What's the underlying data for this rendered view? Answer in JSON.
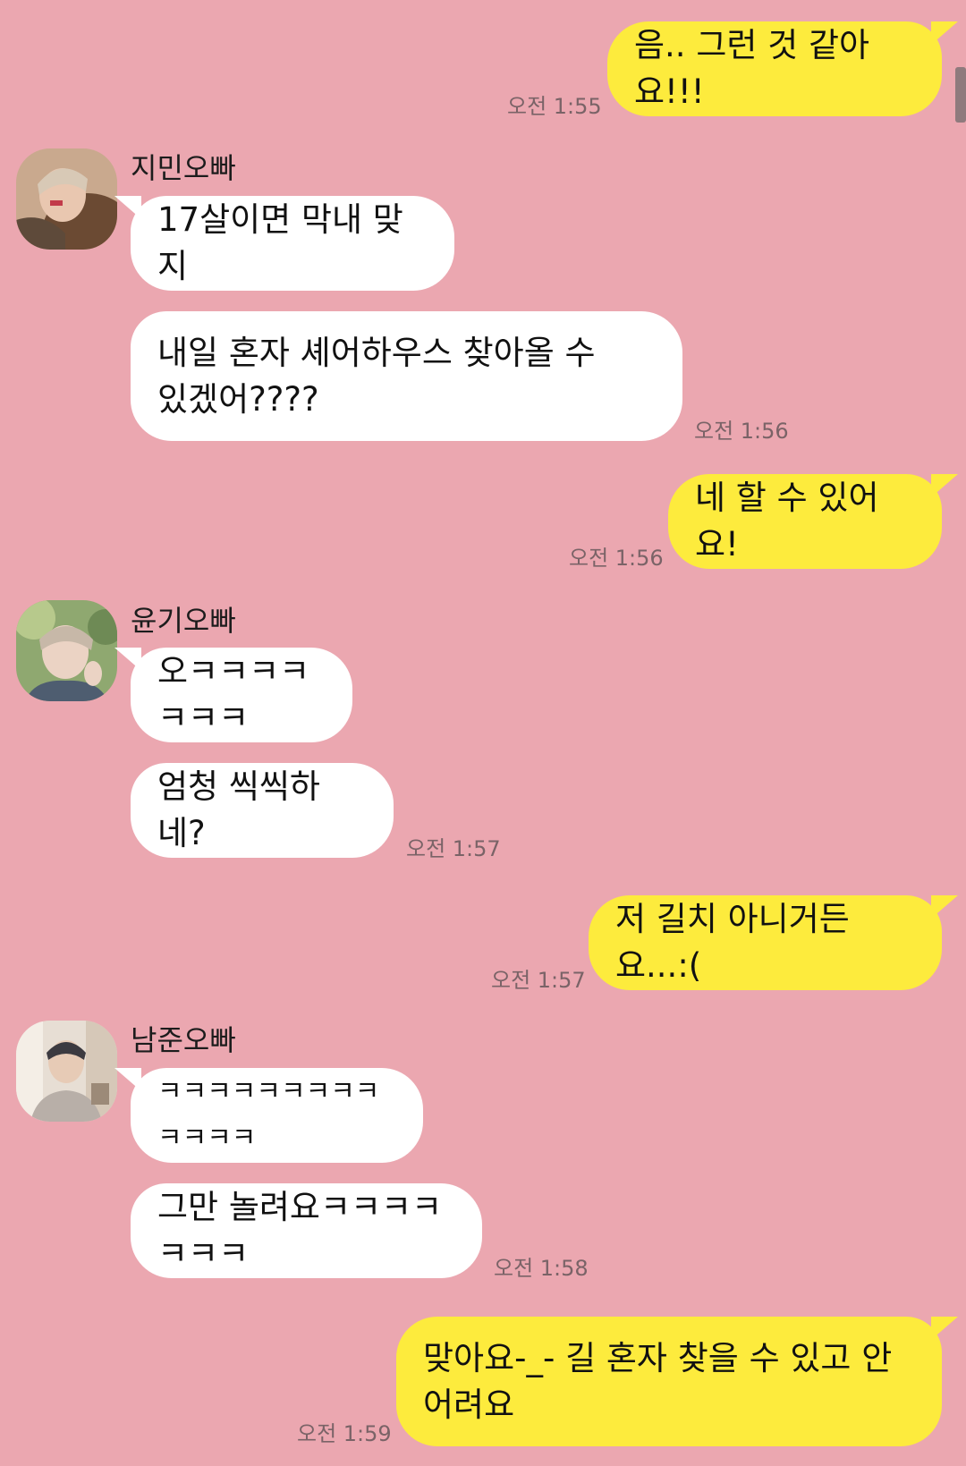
{
  "messages": [
    {
      "text": "음.. 그런 것 같아요!!!",
      "time": "오전 1:55"
    },
    {
      "sender": "지민오빠",
      "text": "17살이면 막내 맞지"
    },
    {
      "text": "내일 혼자 셰어하우스 찾아올 수\n있겠어????",
      "time": "오전 1:56"
    },
    {
      "text": "네 할 수 있어요!",
      "time": "오전 1:56"
    },
    {
      "sender": "윤기오빠",
      "text": "오ㅋㅋㅋㅋㅋㅋㅋ"
    },
    {
      "text": "엄청 씩씩하네?",
      "time": "오전 1:57"
    },
    {
      "text": "저 길치 아니거든요...:(",
      "time": "오전 1:57"
    },
    {
      "sender": "남준오빠",
      "text": "ㅋㅋㅋㅋㅋㅋㅋㅋㅋㅋㅋㅋㅋ"
    },
    {
      "text": "그만 놀려요ㅋㅋㅋㅋㅋㅋㅋ",
      "time": "오전 1:58"
    },
    {
      "text": "맞아요-_- 길 혼자 찾을 수 있고 안\n어려요",
      "time": "오전 1:59"
    }
  ],
  "colors": {
    "background": "#EBA7B0",
    "my_bubble": "#FDEB3D",
    "other_bubble": "#FFFFFF"
  }
}
